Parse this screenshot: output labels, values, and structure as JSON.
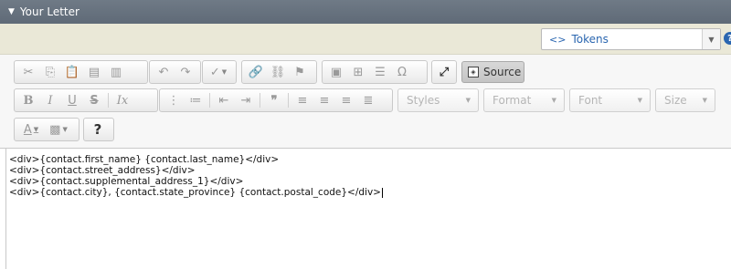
{
  "header": {
    "title": "Your Letter",
    "caret": "▼"
  },
  "tokens": {
    "label": "Tokens",
    "icon": "code-icon",
    "arrow": "▼",
    "help": "?"
  },
  "toolbar": {
    "source_label": "Source",
    "help_label": "?",
    "styles_label": "Styles",
    "format_label": "Format",
    "font_label": "Font",
    "size_label": "Size"
  },
  "content": {
    "lines": [
      "<div>{contact.first_name} {contact.last_name}</div>",
      "<div>{contact.street_address}</div>",
      "<div>{contact.supplemental_address_1}</div>",
      "<div>{contact.city}, {contact.state_province} {contact.postal_code}</div>"
    ]
  }
}
